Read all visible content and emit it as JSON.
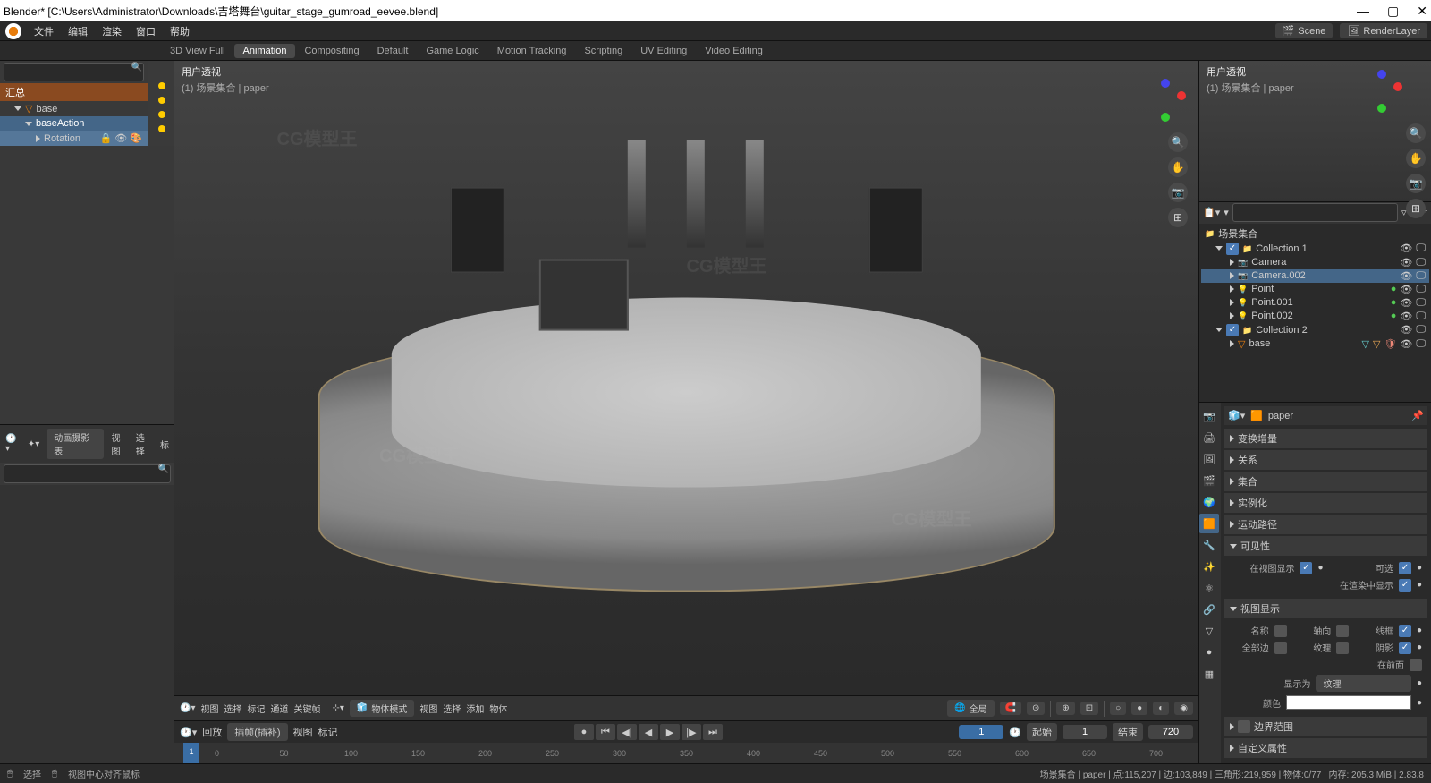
{
  "title": "Blender* [C:\\Users\\Administrator\\Downloads\\吉塔舞台\\guitar_stage_gumroad_eevee.blend]",
  "menu": {
    "file": "文件",
    "edit": "编辑",
    "render": "渲染",
    "window": "窗口",
    "help": "帮助"
  },
  "workspaces": {
    "t1": "3D View Full",
    "t2": "Animation",
    "t3": "Compositing",
    "t4": "Default",
    "t5": "Game Logic",
    "t6": "Motion Tracking",
    "t7": "Scripting",
    "t8": "UV Editing",
    "t9": "Video Editing"
  },
  "scene_dd": {
    "icon": "🎬",
    "label": "Scene"
  },
  "layer_dd": {
    "icon": "🖼",
    "label": "RenderLayer"
  },
  "outliner_left": {
    "summary": "汇总",
    "base": "base",
    "baseAction": "baseAction",
    "rotation": "Rotation"
  },
  "dopesheet_header": {
    "dd1": "动画摄影表",
    "dd2": "视图",
    "sel": "选择",
    "mark": "标"
  },
  "dopesheet_bottom_header": {
    "play": "回放",
    "keying": "插帧(插补)",
    "view": "视图",
    "marker": "标记"
  },
  "viewport_header": {
    "persp": "用户透视",
    "collection": "(1) 场景集合 | paper"
  },
  "viewport_toolbar": {
    "view": "视图",
    "select": "选择",
    "mark": "标记",
    "channel": "通道",
    "keyframe": "关键帧",
    "objmode": "物体模式",
    "view2": "视图",
    "select2": "选择",
    "add": "添加",
    "object": "物体",
    "global": "全局"
  },
  "timeline": {
    "tick0": "0",
    "tick50": "50",
    "tick100": "100",
    "tick150": "150",
    "tick200": "200",
    "tick250": "250",
    "tick300": "300",
    "tick350": "350",
    "tick400": "400",
    "tick450": "450",
    "tick500": "500",
    "tick550": "550",
    "tick600": "600",
    "tick650": "650",
    "tick700": "700",
    "curframe": "1",
    "frame_val": "1",
    "start_lbl": "起始",
    "start_val": "1",
    "end_lbl": "结束",
    "end_val": "720"
  },
  "outliner": {
    "root": "场景集合",
    "col1": "Collection 1",
    "camera": "Camera",
    "camera002": "Camera.002",
    "point": "Point",
    "point001": "Point.001",
    "point002": "Point.002",
    "col2": "Collection 2",
    "base": "base"
  },
  "props": {
    "obj_name": "paper",
    "sec_transform": "变换增量",
    "sec_relations": "关系",
    "sec_collections": "集合",
    "sec_instancing": "实例化",
    "sec_motion": "运动路径",
    "sec_visibility": "可见性",
    "sec_viewport": "视图显示",
    "vis_viewport": "在视图显示",
    "vis_selectable": "可选",
    "vis_render": "在渲染中显示",
    "vp_name": "名称",
    "vp_axis": "轴向",
    "vp_wire": "线框",
    "vp_alledges": "全部边",
    "vp_texture": "纹理",
    "vp_shadow": "阴影",
    "vp_infront": "在前面",
    "display_as": "显示为",
    "display_as_val": "纹理",
    "color": "颜色",
    "sec_bounds": "边界范围",
    "sec_custom": "自定义属性"
  },
  "statusbar": {
    "select": "选择",
    "center": "视图中心对齐鼠标",
    "scene_info": "场景集合 | paper | 点:115,207 | 边:103,849 | 三角形:219,959 | 物体:0/77 | 内存: 205.3 MiB | 2.83.8"
  },
  "watermark": "CG模型王"
}
